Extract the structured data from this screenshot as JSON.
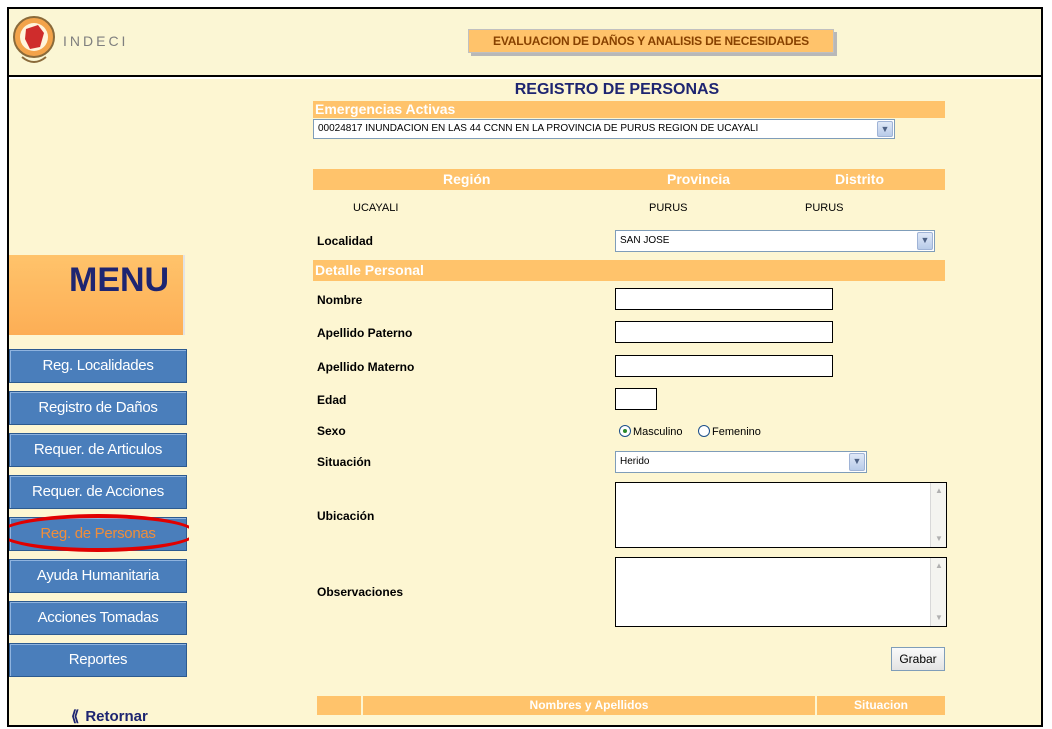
{
  "header": {
    "brand": "INDECI",
    "title": "EVALUACION DE DAÑOS Y ANALISIS DE NECESIDADES"
  },
  "sidebar": {
    "menu_title": "MENU",
    "items": [
      {
        "label": "Reg. Localidades"
      },
      {
        "label": "Registro de Daños"
      },
      {
        "label": "Requer. de Articulos"
      },
      {
        "label": "Requer. de Acciones"
      },
      {
        "label": "Reg. de Personas"
      },
      {
        "label": "Ayuda Humanitaria"
      },
      {
        "label": "Acciones Tomadas"
      },
      {
        "label": "Reportes"
      }
    ],
    "active_item": "Reg. de Personas",
    "retornar": "Retornar"
  },
  "form": {
    "page_title": "REGISTRO DE PERSONAS",
    "emergencias_header": "Emergencias Activas",
    "emergencia_selected": "00024817 INUNDACION EN LAS 44 CCNN EN LA PROVINCIA DE PURUS REGION DE UCAYALI",
    "ubicacion_headers": {
      "region": "Región",
      "provincia": "Provincia",
      "distrito": "Distrito"
    },
    "ubicacion_values": {
      "region": "UCAYALI",
      "provincia": "PURUS",
      "distrito": "PURUS"
    },
    "localidad_label": "Localidad",
    "localidad_selected": "SAN JOSE",
    "detalle_header": "Detalle Personal",
    "nombre_label": "Nombre",
    "nombre_value": "",
    "apellido_paterno_label": "Apellido Paterno",
    "apellido_paterno_value": "",
    "apellido_materno_label": "Apellido Materno",
    "apellido_materno_value": "",
    "edad_label": "Edad",
    "edad_value": "",
    "sexo_label": "Sexo",
    "sexo_options": [
      "Masculino",
      "Femenino"
    ],
    "sexo_selected": "Masculino",
    "situacion_label": "Situación",
    "situacion_selected": "Herido",
    "ubicacion_label": "Ubicación",
    "ubicacion_value": "",
    "observaciones_label": "Observaciones",
    "observaciones_value": "",
    "grabar_label": "Grabar"
  },
  "table": {
    "headers": [
      "Nombres y Apellidos",
      "Situacion"
    ]
  },
  "colors": {
    "accent_orange": "#ffc36b",
    "nav_blue": "#4a7ebb",
    "menu_text": "#1e2571",
    "background": "#fdf6d2",
    "highlight_ring": "#e10000"
  }
}
